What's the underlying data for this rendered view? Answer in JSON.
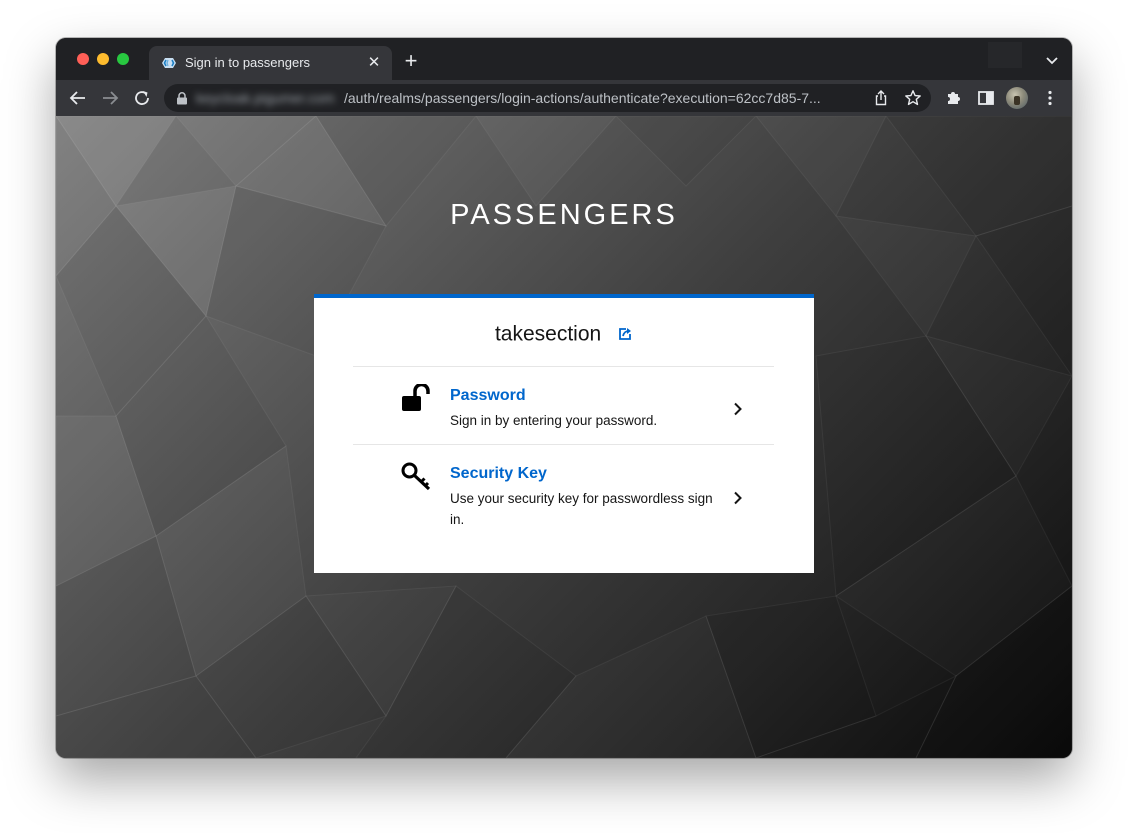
{
  "browser": {
    "tab": {
      "title": "Sign in to passengers",
      "close_glyph": "✕"
    },
    "new_tab_glyph": "+",
    "url": {
      "host": "keycloak.pigumer.com",
      "path": "/auth/realms/passengers/login-actions/authenticate?execution=62cc7d85-7..."
    },
    "icons": {
      "back": "back-arrow-icon",
      "forward": "forward-arrow-icon",
      "reload": "reload-icon",
      "lock": "lock-icon",
      "share": "share-icon",
      "bookmark": "star-icon",
      "extensions": "puzzle-icon",
      "side_panel": "side-panel-icon",
      "menu": "kebab-menu-icon",
      "tab_search": "chevron-down-icon"
    }
  },
  "login": {
    "realm_title": "PASSENGERS",
    "username": "takesection",
    "accent_color": "#0066cc",
    "options": [
      {
        "icon": "unlock-icon",
        "title": "Password",
        "description": "Sign in by entering your password."
      },
      {
        "icon": "key-icon",
        "title": "Security Key",
        "description": "Use your security key for passwordless sign in."
      }
    ]
  }
}
